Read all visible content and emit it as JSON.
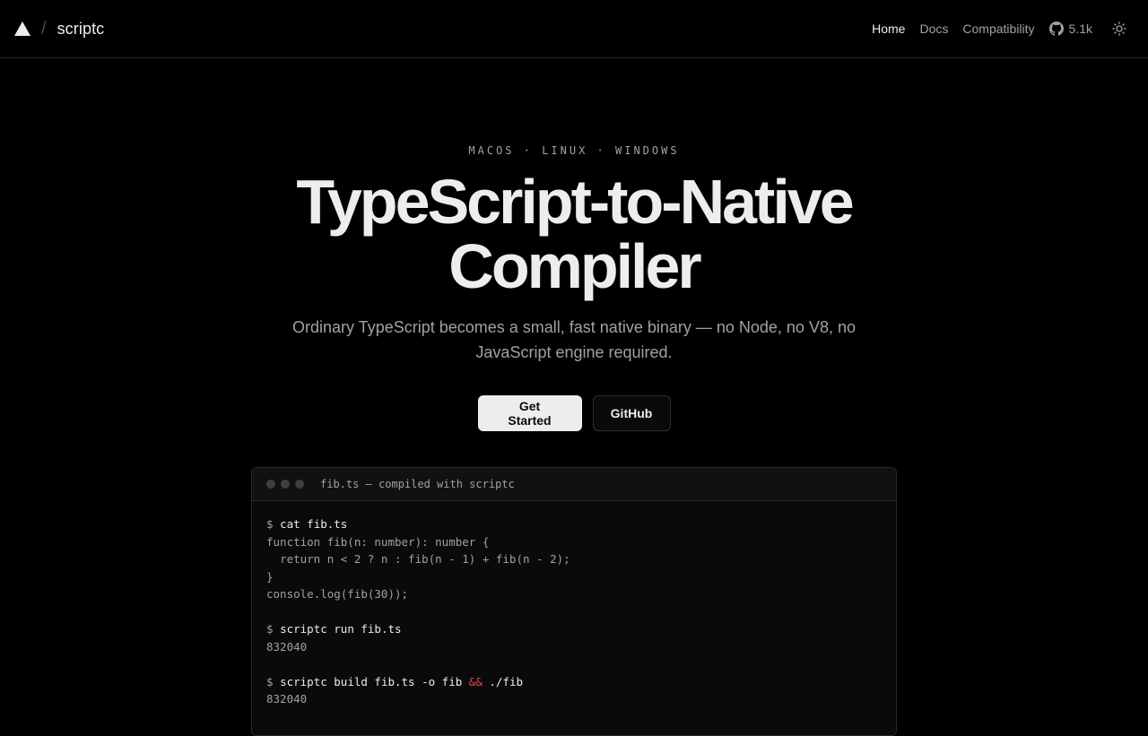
{
  "nav": {
    "brand_name": "scriptc",
    "slash": "/",
    "links": [
      {
        "label": "Home",
        "active": true
      },
      {
        "label": "Docs",
        "active": false
      },
      {
        "label": "Compatibility",
        "active": false
      }
    ],
    "github_stars": "5.1k",
    "icons": {
      "logo": "triangle-logo-icon",
      "github": "github-icon",
      "theme": "sun-icon"
    }
  },
  "hero": {
    "platforms": "MACOS · LINUX · WINDOWS",
    "title_line1": "TypeScript-to-Native",
    "title_line2": "Compiler",
    "subtitle": "Ordinary TypeScript becomes a small, fast native binary — no Node, no V8, no JavaScript engine required.",
    "primary_button": "Get Started",
    "secondary_button": "GitHub"
  },
  "terminal": {
    "title": "fib.ts — compiled with scriptc",
    "prompt": "$",
    "cmd1": "cat fib.ts",
    "code": [
      "function fib(n: number): number {",
      "  return n < 2 ? n : fib(n - 1) + fib(n - 2);",
      "}",
      "console.log(fib(30));"
    ],
    "cmd2": "scriptc run fib.ts",
    "out2": "832040",
    "cmd3_part1": "scriptc build fib.ts -o fib",
    "cmd3_op": "&&",
    "cmd3_part2": "./fib",
    "out3": "832040"
  },
  "colors": {
    "background": "#000000",
    "text": "#ededed",
    "muted": "#a1a1a1",
    "accent_operator": "#e5484d"
  }
}
